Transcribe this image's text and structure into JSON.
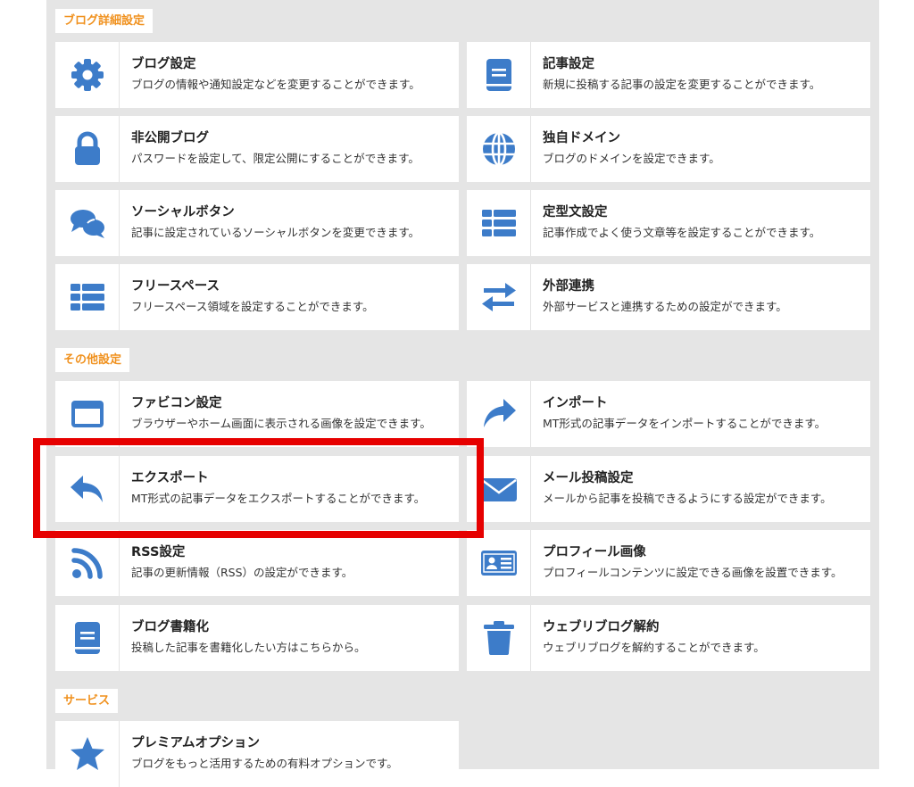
{
  "sections": [
    {
      "label": "ブログ詳細設定"
    },
    {
      "label": "その他設定"
    },
    {
      "label": "サービス"
    }
  ],
  "icon_color": "#3d7cc9",
  "highlight_color": "#e60000",
  "items": [
    {
      "title": "ブログ設定",
      "desc": "ブログの情報や通知設定などを変更することができます。",
      "icon": "gear-icon"
    },
    {
      "title": "記事設定",
      "desc": "新規に投稿する記事の設定を変更することができます。",
      "icon": "article-icon"
    },
    {
      "title": "非公開ブログ",
      "desc": "パスワードを設定して、限定公開にすることができます。",
      "icon": "lock-icon"
    },
    {
      "title": "独自ドメイン",
      "desc": "ブログのドメインを設定できます。",
      "icon": "globe-icon"
    },
    {
      "title": "ソーシャルボタン",
      "desc": "記事に設定されているソーシャルボタンを変更できます。",
      "icon": "comments-icon"
    },
    {
      "title": "定型文設定",
      "desc": "記事作成でよく使う文章等を設定することができます。",
      "icon": "list-icon"
    },
    {
      "title": "フリースペース",
      "desc": "フリースペース領域を設定することができます。",
      "icon": "list-icon"
    },
    {
      "title": "外部連携",
      "desc": "外部サービスと連携するための設定ができます。",
      "icon": "exchange-icon"
    },
    {
      "title": "ファビコン設定",
      "desc": "ブラウザーやホーム画面に表示される画像を設定できます。",
      "icon": "window-icon"
    },
    {
      "title": "インポート",
      "desc": "MT形式の記事データをインポートすることができます。",
      "icon": "share-arrow-icon"
    },
    {
      "title": "エクスポート",
      "desc": "MT形式の記事データをエクスポートすることができます。",
      "icon": "reply-arrow-icon"
    },
    {
      "title": "メール投稿設定",
      "desc": "メールから記事を投稿できるようにする設定ができます。",
      "icon": "envelope-icon"
    },
    {
      "title": "RSS設定",
      "desc": "記事の更新情報（RSS）の設定ができます。",
      "icon": "rss-icon"
    },
    {
      "title": "プロフィール画像",
      "desc": "プロフィールコンテンツに設定できる画像を設置できます。",
      "icon": "id-card-icon"
    },
    {
      "title": "ブログ書籍化",
      "desc": "投稿した記事を書籍化したい方はこちらから。",
      "icon": "book-icon"
    },
    {
      "title": "ウェブリブログ解約",
      "desc": "ウェブリブログを解約することができます。",
      "icon": "trash-icon"
    },
    {
      "title": "プレミアムオプション",
      "desc": "ブログをもっと活用するための有料オプションです。",
      "icon": "star-icon"
    }
  ]
}
